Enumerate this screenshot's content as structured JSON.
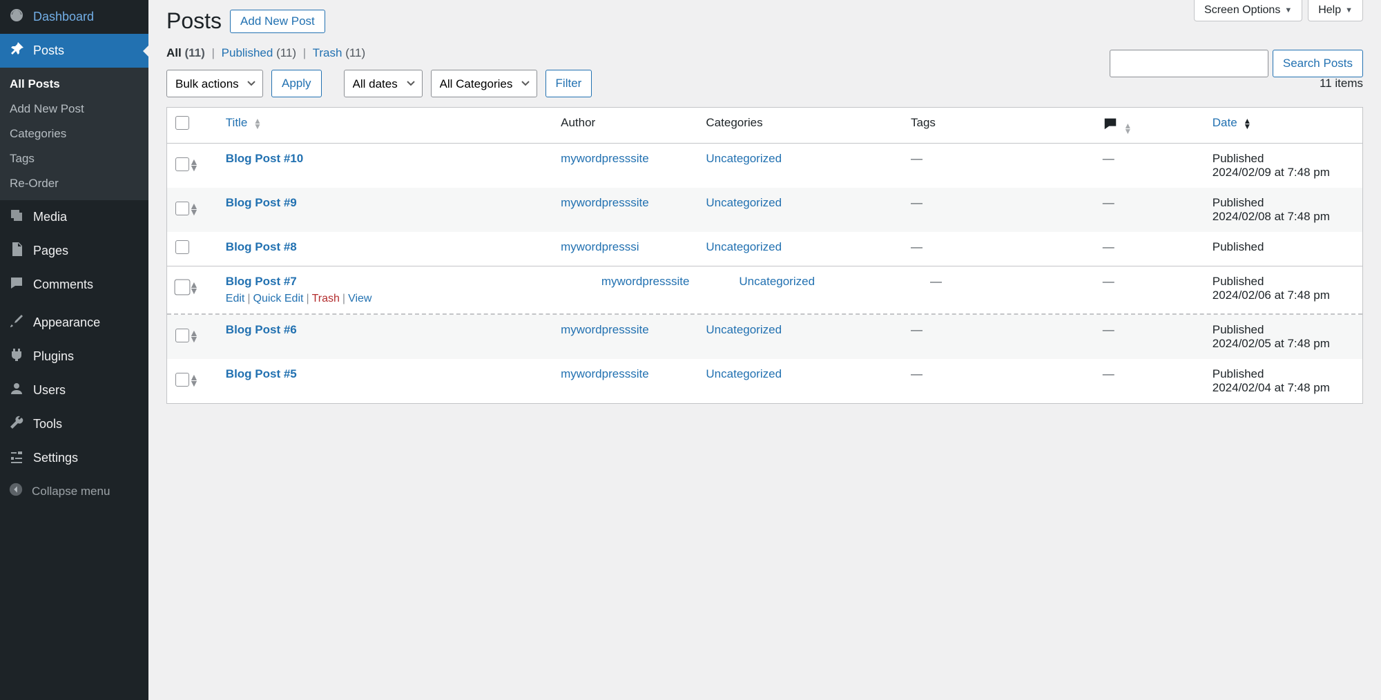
{
  "top_tabs": {
    "screen_options": "Screen Options",
    "help": "Help"
  },
  "sidebar": {
    "items": [
      {
        "id": "dashboard",
        "label": "Dashboard",
        "icon": "gauge-icon"
      },
      {
        "id": "posts",
        "label": "Posts",
        "icon": "pin-icon"
      },
      {
        "id": "media",
        "label": "Media",
        "icon": "media-icon"
      },
      {
        "id": "pages",
        "label": "Pages",
        "icon": "pages-icon"
      },
      {
        "id": "comments",
        "label": "Comments",
        "icon": "comments-icon"
      },
      {
        "id": "appearance",
        "label": "Appearance",
        "icon": "brush-icon"
      },
      {
        "id": "plugins",
        "label": "Plugins",
        "icon": "plug-icon"
      },
      {
        "id": "users",
        "label": "Users",
        "icon": "user-icon"
      },
      {
        "id": "tools",
        "label": "Tools",
        "icon": "wrench-icon"
      },
      {
        "id": "settings",
        "label": "Settings",
        "icon": "sliders-icon"
      }
    ],
    "posts_submenu": {
      "all_posts": "All Posts",
      "add_new": "Add New Post",
      "categories": "Categories",
      "tags": "Tags",
      "reorder": "Re-Order"
    },
    "collapse": "Collapse menu"
  },
  "page": {
    "title": "Posts",
    "add_new": "Add New Post"
  },
  "views": {
    "all_label": "All",
    "all_count": "(11)",
    "published_label": "Published",
    "published_count": "(11)",
    "trash_label": "Trash",
    "trash_count": "(11)"
  },
  "controls": {
    "bulk_actions": "Bulk actions",
    "apply": "Apply",
    "all_dates": "All dates",
    "all_categories": "All Categories",
    "filter": "Filter",
    "items_label": "11 items",
    "search_button": "Search Posts",
    "search_value": ""
  },
  "columns": {
    "title": "Title",
    "author": "Author",
    "categories": "Categories",
    "tags": "Tags",
    "date": "Date"
  },
  "row_actions": {
    "edit": "Edit",
    "quick_edit": "Quick Edit",
    "trash": "Trash",
    "view": "View"
  },
  "dash": "—",
  "rows": [
    {
      "title": "Blog Post #10",
      "author": "mywordpresssite",
      "category": "Uncategorized",
      "date_status": "Published",
      "date": "2024/02/09 at 7:48 pm",
      "hovered": false,
      "truncated": false
    },
    {
      "title": "Blog Post #9",
      "author": "mywordpresssite",
      "category": "Uncategorized",
      "date_status": "Published",
      "date": "2024/02/08 at 7:48 pm",
      "hovered": false,
      "truncated": false
    },
    {
      "title": "Blog Post #8",
      "author": "mywordpresssi",
      "category": "Uncategorized",
      "date_status": "Published",
      "date": "",
      "hovered": false,
      "truncated": true
    },
    {
      "title": "Blog Post #7",
      "author": "mywordpresssite",
      "category": "Uncategorized",
      "date_status": "Published",
      "date": "2024/02/06 at 7:48 pm",
      "hovered": true,
      "truncated": false
    },
    {
      "title": "Blog Post #6",
      "author": "mywordpresssite",
      "category": "Uncategorized",
      "date_status": "Published",
      "date": "2024/02/05 at 7:48 pm",
      "hovered": false,
      "truncated": false
    },
    {
      "title": "Blog Post #5",
      "author": "mywordpresssite",
      "category": "Uncategorized",
      "date_status": "Published",
      "date": "2024/02/04 at 7:48 pm",
      "hovered": false,
      "truncated": false
    }
  ]
}
